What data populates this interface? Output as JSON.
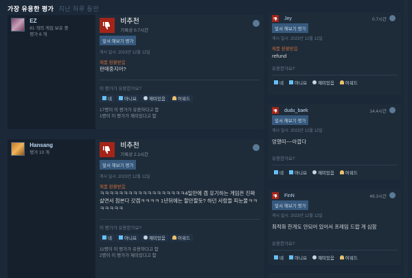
{
  "heading": {
    "active": "가장 유용한 평가",
    "inactive": "지난 하루 동안"
  },
  "reviews": [
    {
      "author": {
        "name": "EZ",
        "games": "81 개의 게임 보유 중",
        "reviews": "평가 6 개"
      },
      "verdict": "비추천",
      "hours": "기록상 0.7시간",
      "badge": "앞서 해보기 평가",
      "posted": "게시 일시: 2023년 12월 12일",
      "refund": "제품 환불받음",
      "body": "판매중지어?",
      "helpful_q": "이 평가가 유용한가요?",
      "votes": {
        "yes": "네",
        "no": "아니요",
        "funny": "재미있음",
        "award": "어워드"
      },
      "stats1": "17명이 이 평가가 유용하다고 함",
      "stats2": "1명이 이 평가가 재미있다고 함"
    },
    {
      "author": {
        "name": "Hansang",
        "games": "",
        "reviews": "평가 10 개"
      },
      "verdict": "비추천",
      "hours": "기록상 2.1시간",
      "badge": "앞서 해보기 평가",
      "posted": "게시 일시: 2023년 12월 12일",
      "refund": "제품 환불받음",
      "body": "ㅋㅋㅋㅋㅋㅋㅋㅋㅋㅋㅋㅋㅋㅋㅋㅋㅋㅋ4일만에 겜 유기하는 게임은 진짜 살면서 첨본다 갓겜ㅋㅋㅋㅋ 1년뒤에는 할만할듯? 하던 사람들 피눈물ㅋㅋㅋㅋㅋㅋㅋ",
      "helpful_q": "이 평가가 유용한가요?",
      "votes": {
        "yes": "네",
        "no": "아니요",
        "funny": "재미있음",
        "award": "어워드"
      },
      "stats1": "11명이 이 평가가 유용하다고 함",
      "stats2": "2명이 이 평가가 재미있다고 함"
    }
  ],
  "side": [
    {
      "name": "Jey",
      "hours": "0.7시간",
      "badge": "앞서 해보기 평가",
      "posted": "게시 일시: 2023년 12월 12일",
      "refund": "제품 환불받음",
      "body": "refund",
      "helpful_q": "유용한가요?",
      "votes": {
        "yes": "네",
        "no": "아니요",
        "funny": "재미있음",
        "award": "어워드"
      }
    },
    {
      "name": "dudu_baek",
      "hours": "14.4시간",
      "badge": "앞서 해보기 평가",
      "posted": "게시 일시: 2023년 12월 12일",
      "refund": "",
      "body": "엉했띠~~아깝다",
      "helpful_q": "유용한가요?",
      "votes": {
        "yes": "네",
        "no": "아니요",
        "funny": "재미있음",
        "award": "어워드"
      }
    },
    {
      "name": "FinN",
      "hours": "49.3시간",
      "badge": "앞서 해보기 평가",
      "posted": "게시 일시: 2023년 12월 12일",
      "refund": "",
      "body": "최적화 한개도 안되어 있어서 프레임 드랍 개 심함",
      "helpful_q": "유용한가요?",
      "votes": {
        "yes": "네",
        "no": "아니요",
        "funny": "재미있음",
        "award": "어워드"
      }
    }
  ]
}
